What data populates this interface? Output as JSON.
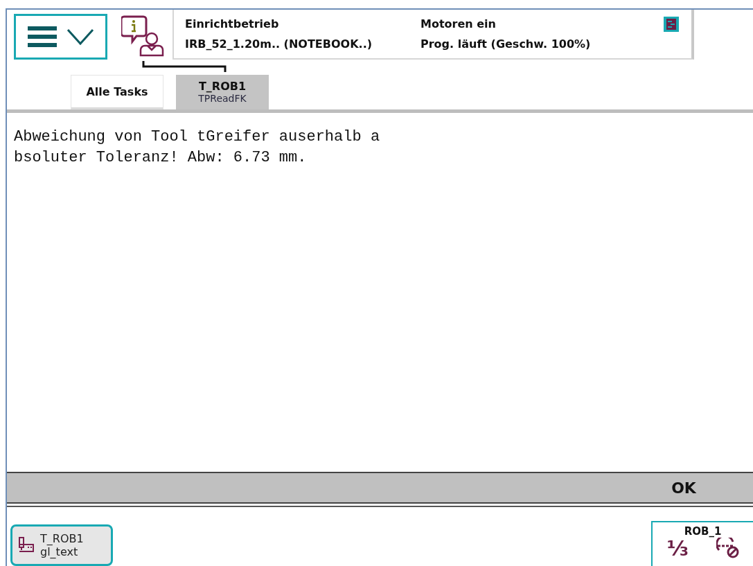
{
  "status": {
    "mode": "Einrichtbetrieb",
    "system": "IRB_52_1.20m.. (NOTEBOOK..)",
    "motors": "Motoren ein",
    "program": "Prog. läuft (Geschw. 100%)"
  },
  "tabs": [
    {
      "label": "Alle Tasks",
      "selected": false
    },
    {
      "label": "T_ROB1",
      "sublabel": "TPReadFK",
      "selected": true
    }
  ],
  "message": {
    "lines": [
      "Abweichung von Tool tGreifer auserhalb a",
      "bsoluter Toleranz! Abw: 6.73 mm."
    ]
  },
  "buttons": [
    "OK"
  ],
  "taskbar": {
    "task": {
      "title": "T_ROB1",
      "subtitle": "gl_text"
    },
    "robot": {
      "name": "ROB_1",
      "fraction": "⅓"
    }
  }
}
